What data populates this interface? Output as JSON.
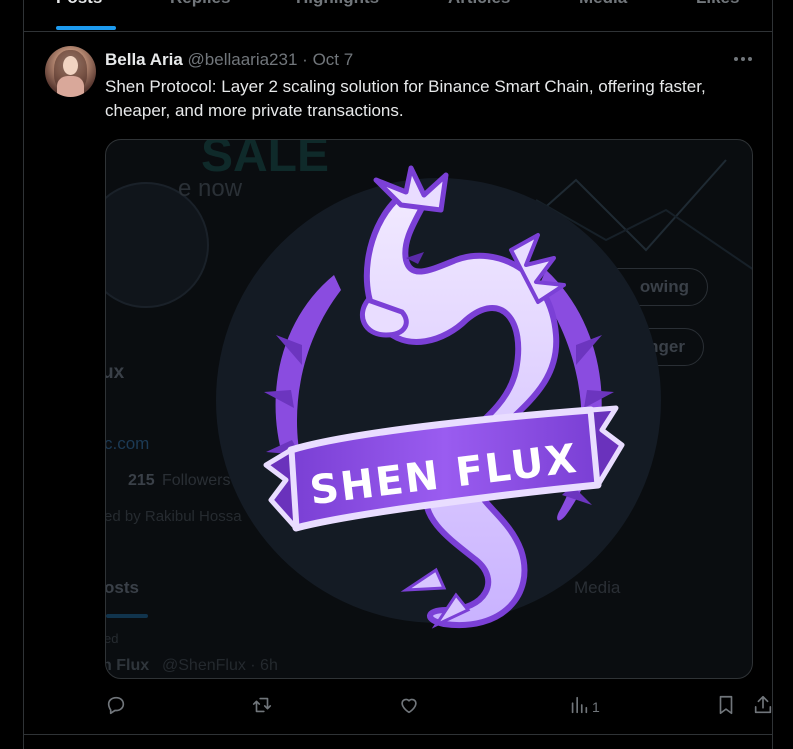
{
  "tabs": [
    {
      "label": "Posts",
      "active": true
    },
    {
      "label": "Replies",
      "active": false
    },
    {
      "label": "Highlights",
      "active": false
    },
    {
      "label": "Articles",
      "active": false
    },
    {
      "label": "Media",
      "active": false
    },
    {
      "label": "Likes",
      "active": false
    }
  ],
  "post": {
    "author_name": "Bella Aria",
    "author_handle": "@bellaaria231",
    "separator": "·",
    "date": "Oct 7",
    "text": "Shen Protocol: Layer 2 scaling solution for Binance Smart Chain, offering faster, cheaper, and more private transactions.",
    "avatar_icon": "profile-photo",
    "more_icon": "more-dots-icon"
  },
  "media": {
    "logo_text": "SHEN FLUX",
    "background": {
      "banner_text": "SALE",
      "banner_sub": "e now",
      "name_fragment": "ux",
      "link_fragment": "c.com",
      "followers_count": "215",
      "followers_label": "Followers",
      "pinned_by": "ed by Rakibul Hossa",
      "following_button": "owing",
      "danger_button": "nger",
      "tab_posts": "osts",
      "tab_media": "Media",
      "pinned_label": "ed",
      "row_author": "n Flux",
      "row_handle": "@ShenFlux · 6h"
    },
    "colors": {
      "purple": "#8e4fe0",
      "lavender": "#e9ddff",
      "circle": "#141b24"
    }
  },
  "actions": {
    "reply_icon": "reply-icon",
    "repost_icon": "repost-icon",
    "like_icon": "heart-icon",
    "views_icon": "views-chart-icon",
    "views_count": "1",
    "bookmark_icon": "bookmark-icon",
    "share_icon": "share-icon"
  },
  "colors": {
    "accent": "#1d9bf0",
    "text": "#e7e9ea",
    "muted": "#71767b",
    "border": "#2f3336",
    "background": "#000000"
  }
}
